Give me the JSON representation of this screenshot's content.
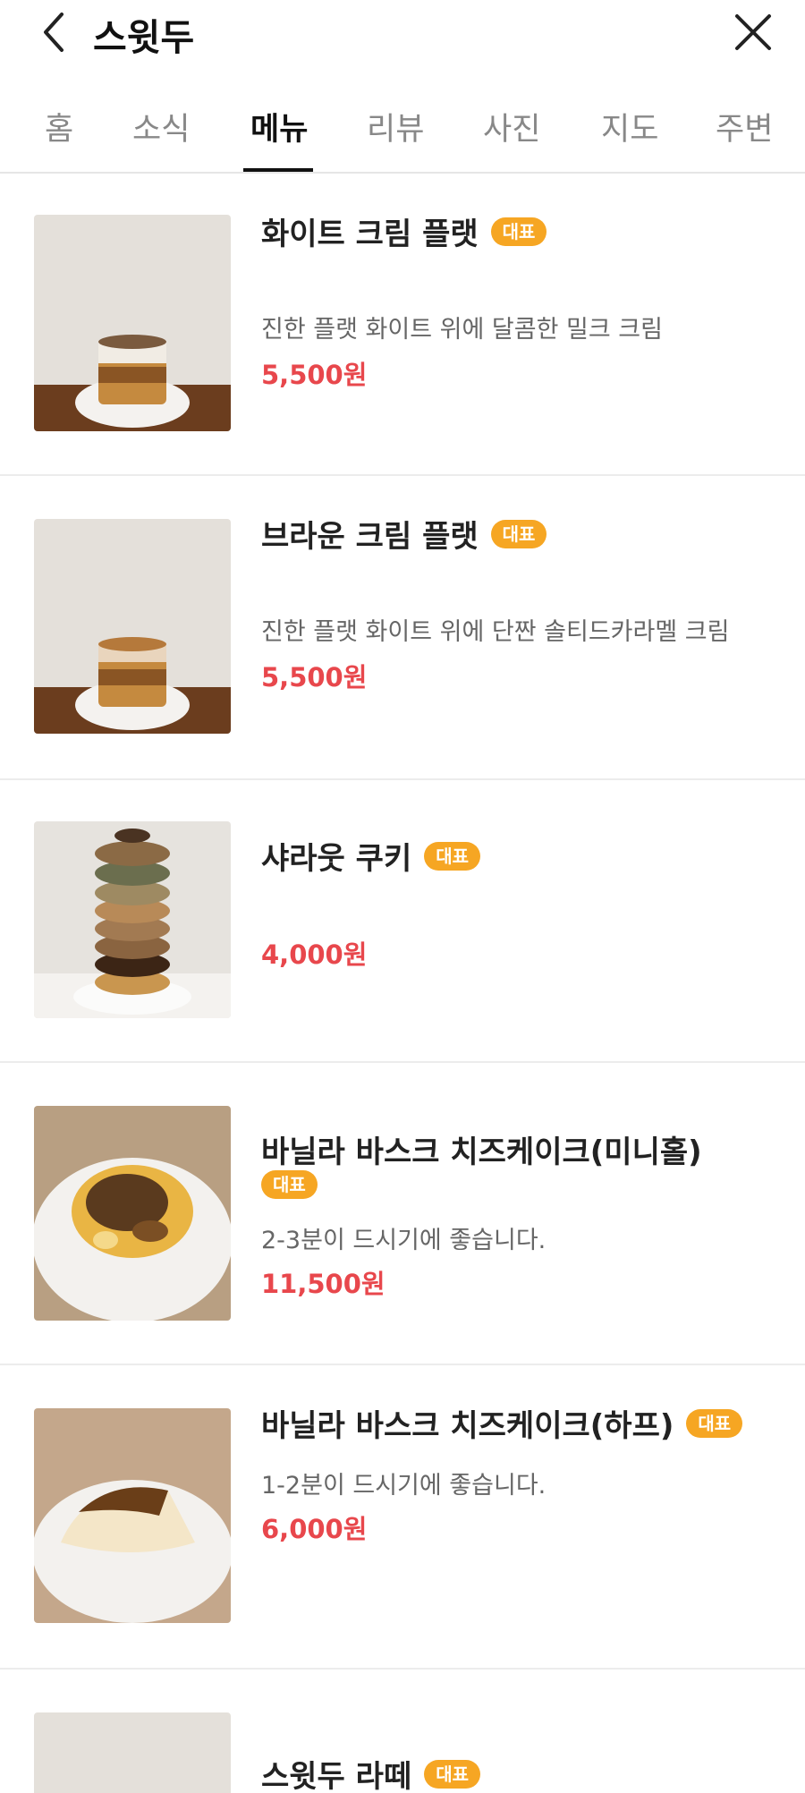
{
  "header": {
    "title": "스윗두"
  },
  "tabs": [
    {
      "label": "홈"
    },
    {
      "label": "소식"
    },
    {
      "label": "메뉴"
    },
    {
      "label": "리뷰"
    },
    {
      "label": "사진"
    },
    {
      "label": "지도"
    },
    {
      "label": "주변"
    }
  ],
  "menu": [
    {
      "name": "화이트 크림 플랫",
      "badge": "대표",
      "desc": "진한 플랫 화이트 위에 달콤한 밀크 크림",
      "price": "5,500원"
    },
    {
      "name": "브라운 크림 플랫",
      "badge": "대표",
      "desc": "진한 플랫 화이트 위에 단짠 솔티드카라멜 크림",
      "price": "5,500원"
    },
    {
      "name": "샤라웃 쿠키",
      "badge": "대표",
      "price": "4,000원"
    },
    {
      "name": "바닐라 바스크 치즈케이크(미니홀)",
      "badge": "대표",
      "desc": "2-3분이 드시기에 좋습니다.",
      "price": "11,500원"
    },
    {
      "name": "바닐라 바스크 치즈케이크(하프)",
      "badge": "대표",
      "desc": "1-2분이 드시기에 좋습니다.",
      "price": "6,000원"
    },
    {
      "name": "스윗두 라떼",
      "badge": "대표"
    }
  ],
  "colors": {
    "accent_price": "#e8474c",
    "badge": "#f6a623",
    "tab_active": "#111111"
  }
}
